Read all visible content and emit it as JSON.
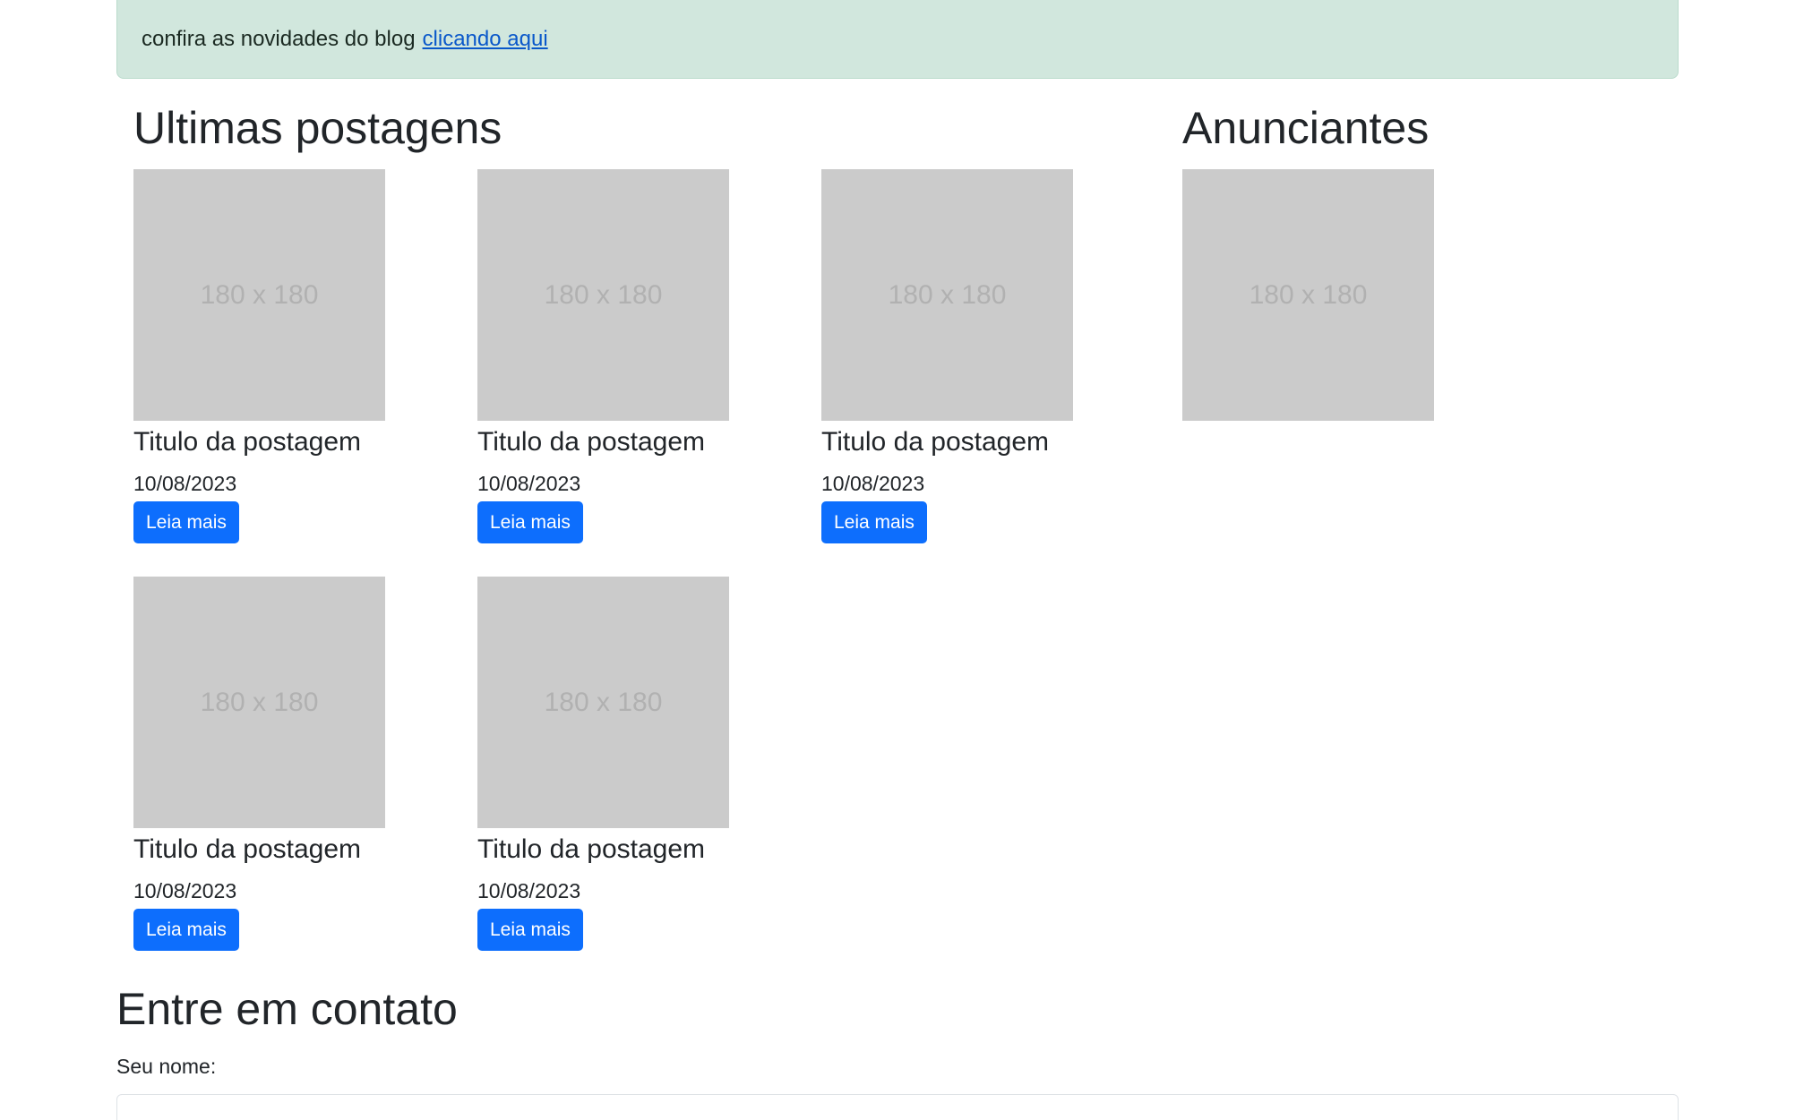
{
  "alert": {
    "text": "confira as novidades do blog",
    "link_label": "clicando aqui"
  },
  "posts_section": {
    "title": "Ultimas postagens",
    "posts": [
      {
        "thumb_label": "180 x 180",
        "title": "Titulo da postagem",
        "date": "10/08/2023",
        "button_label": "Leia mais"
      },
      {
        "thumb_label": "180 x 180",
        "title": "Titulo da postagem",
        "date": "10/08/2023",
        "button_label": "Leia mais"
      },
      {
        "thumb_label": "180 x 180",
        "title": "Titulo da postagem",
        "date": "10/08/2023",
        "button_label": "Leia mais"
      },
      {
        "thumb_label": "180 x 180",
        "title": "Titulo da postagem",
        "date": "10/08/2023",
        "button_label": "Leia mais"
      },
      {
        "thumb_label": "180 x 180",
        "title": "Titulo da postagem",
        "date": "10/08/2023",
        "button_label": "Leia mais"
      }
    ]
  },
  "ads_section": {
    "title": "Anunciantes",
    "thumb_label": "180 x 180"
  },
  "contact": {
    "title": "Entre em contato",
    "name_label": "Seu nome:",
    "name_value": ""
  },
  "colors": {
    "alert_bg": "#d1e7dd",
    "primary": "#0d6efd",
    "placeholder_bg": "#cbcbcb",
    "link": "#0a58ca"
  }
}
